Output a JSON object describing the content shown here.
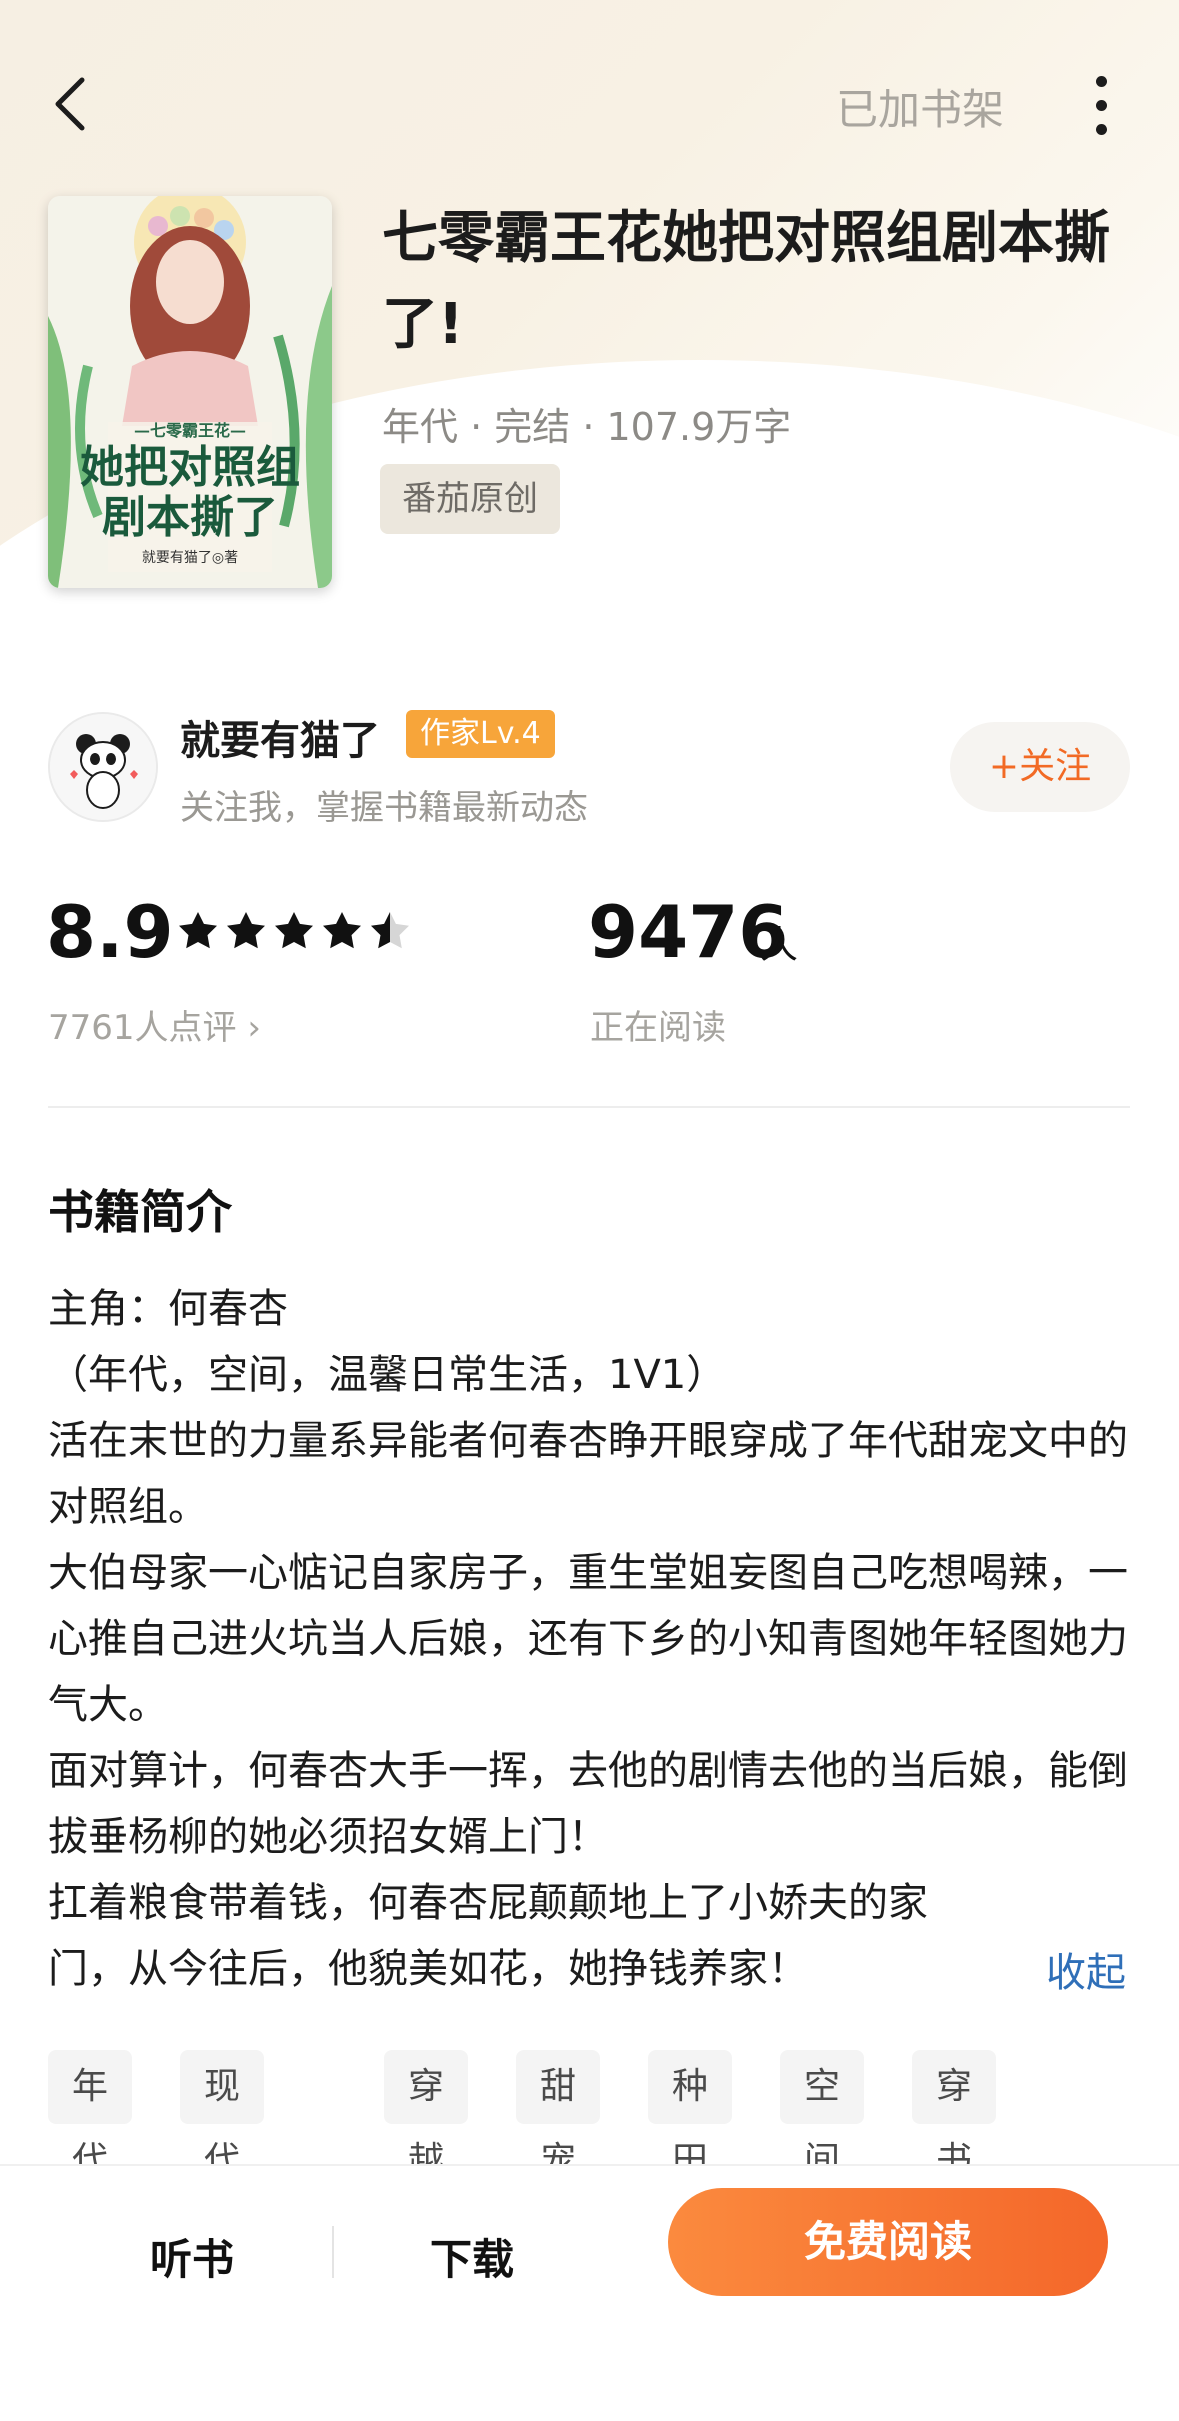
{
  "header": {
    "shelf_label": "已加书架"
  },
  "book": {
    "title": "七零霸王花她把对照组剧本撕了!",
    "meta": "年代 · 完结 · 107.9万字",
    "publisher": "番茄原创",
    "cover": {
      "series": "—七零霸王花—",
      "line1": "她把对照组",
      "line2": "剧本撕了",
      "author": "就要有猫了◎著"
    }
  },
  "author": {
    "name": "就要有猫了",
    "badge": "作家Lv.4",
    "subtitle": "关注我，掌握书籍最新动态",
    "follow_label": "+关注"
  },
  "stats": {
    "score": "8.9",
    "rating_stars": 4.5,
    "reviews": "7761人点评 ›",
    "readers": "9476",
    "readers_unit": "人",
    "reading_label": "正在阅读"
  },
  "intro": {
    "title": "书籍简介",
    "paragraphs": [
      "主角：何春杏",
      "（年代，空间，温馨日常生活，1V1）",
      "活在末世的力量系异能者何春杏睁开眼穿成了年代甜宠文中的对照组。",
      "大伯母家一心惦记自家房子，重生堂姐妄图自己吃想喝辣，一心推自己进火坑当人后娘，还有下乡的小知青图她年轻图她力气大。",
      "面对算计，何春杏大手一挥，去他的剧情去他的当后娘，能倒拔垂杨柳的她必须招女婿上门！",
      "扛着粮食带着钱，何春杏屁颠颠地上了小娇夫的家门，从今往后，他貌美如花，她挣钱养家！"
    ],
    "collapse_label": "收起"
  },
  "tags": [
    "年代",
    "现代言情",
    "穿越",
    "甜宠",
    "种田",
    "空间",
    "穿书"
  ],
  "bottom": {
    "listen_label": "听书",
    "download_label": "下载",
    "read_label": "免费阅读"
  },
  "colors": {
    "accent": "#f26a25",
    "link": "#2f6fb8",
    "badge": "#f7a53a"
  }
}
